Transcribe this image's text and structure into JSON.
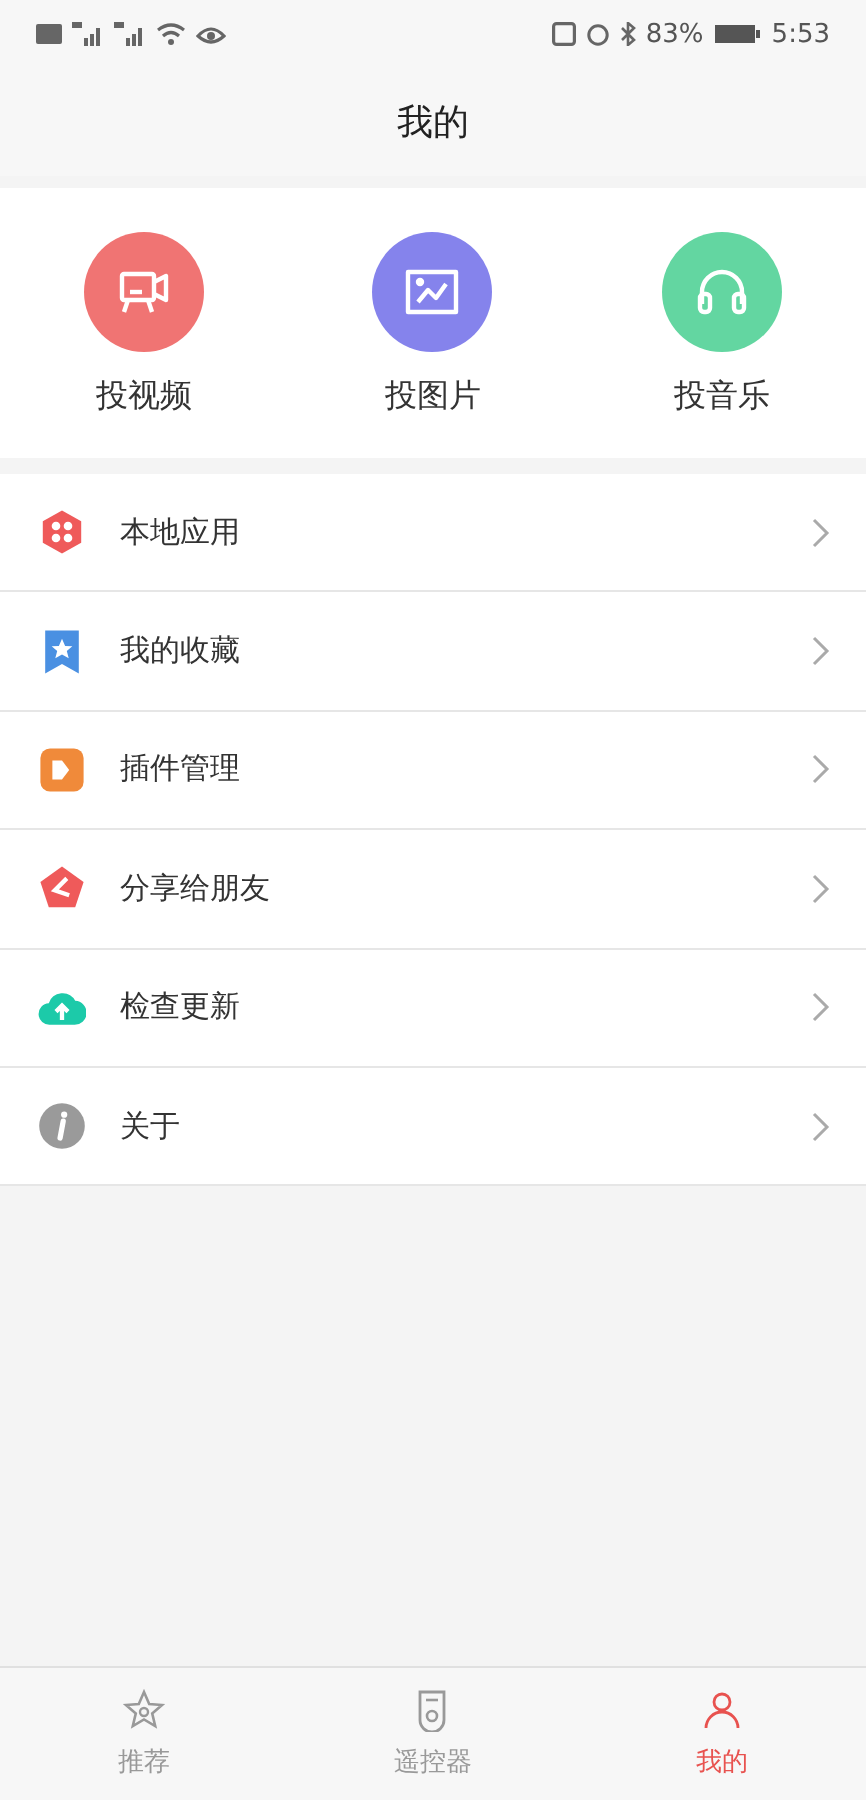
{
  "status_bar": {
    "battery": "83%",
    "time": "5:53"
  },
  "header": {
    "title": "我的"
  },
  "cast_actions": [
    {
      "label": "投视频",
      "kind": "video",
      "color": "#f07473"
    },
    {
      "label": "投图片",
      "kind": "image",
      "color": "#8583ec"
    },
    {
      "label": "投音乐",
      "kind": "music",
      "color": "#63d6a1"
    }
  ],
  "menu": [
    {
      "label": "本地应用",
      "kind": "apps"
    },
    {
      "label": "我的收藏",
      "kind": "favorites"
    },
    {
      "label": "插件管理",
      "kind": "plugins"
    },
    {
      "label": "分享给朋友",
      "kind": "share"
    },
    {
      "label": "检查更新",
      "kind": "update"
    },
    {
      "label": "关于",
      "kind": "about"
    }
  ],
  "tab_bar": [
    {
      "label": "推荐",
      "kind": "star",
      "selected": false
    },
    {
      "label": "遥控器",
      "kind": "remote",
      "selected": false
    },
    {
      "label": "我的",
      "kind": "user",
      "selected": true
    }
  ]
}
